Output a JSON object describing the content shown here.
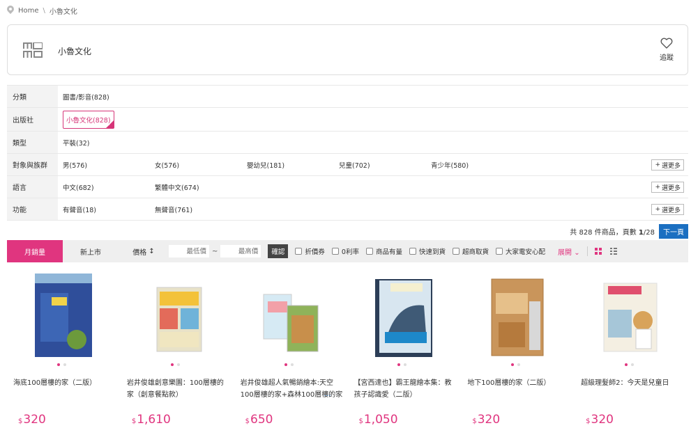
{
  "breadcrumb": {
    "home": "Home",
    "sep": "\\",
    "current": "小魯文化"
  },
  "brand": {
    "logo": "momo",
    "name": "小魯文化",
    "follow_label": "追蹤"
  },
  "filters": [
    {
      "label": "分類",
      "options": [
        "圖書/影音(828)"
      ],
      "more": ""
    },
    {
      "label": "出版社",
      "options": [
        "小魯文化(828)"
      ],
      "selected": 0,
      "more": ""
    },
    {
      "label": "類型",
      "options": [
        "平裝(32)"
      ],
      "more": ""
    },
    {
      "label": "對象與族群",
      "options": [
        "男(576)",
        "女(576)",
        "嬰幼兒(181)",
        "兒童(702)",
        "青少年(580)"
      ],
      "more": "選更多"
    },
    {
      "label": "語言",
      "options": [
        "中文(682)",
        "繁體中文(674)"
      ],
      "more": "選更多"
    },
    {
      "label": "功能",
      "options": [
        "有聲音(18)",
        "無聲音(761)"
      ],
      "more": "選更多"
    }
  ],
  "pageinfo": {
    "prefix": "共",
    "total": "828",
    "mid": "件商品，頁數",
    "current": "1",
    "slash": "/",
    "pages": "28",
    "next": "下一頁"
  },
  "sortbar": {
    "tabs": [
      "月銷量",
      "新上市"
    ],
    "price_label": "價格",
    "price_arrow": "↕",
    "min_placeholder": "最低價",
    "max_placeholder": "最高價",
    "tilde": "~",
    "confirm": "確認",
    "checks": [
      "折價券",
      "0利率",
      "商品有量",
      "快速到貨",
      "超商取貨",
      "大家電安心配"
    ],
    "expand": "展開"
  },
  "products": [
    {
      "name": "海底100層樓的家（二版）",
      "currency": "$",
      "price": "320",
      "cover_color": "#2f4e9a"
    },
    {
      "name": "岩井俊雄創意樂園：100層樓的家（創意餐點款）",
      "currency": "$",
      "price": "1,610",
      "cover_color": "#e8e2c8"
    },
    {
      "name": "岩井俊雄超人氣暢銷繪本:天空100層樓的家+森林100層樓的家",
      "currency": "$",
      "price": "650",
      "cover_color": "#8fb35a"
    },
    {
      "name": "【宮西達也】霸王龍繪本集：教孩子認識愛（二版）",
      "currency": "$",
      "price": "1,050",
      "cover_color": "#3a5f8a"
    },
    {
      "name": "地下100層樓的家（二版）",
      "currency": "$",
      "price": "320",
      "cover_color": "#c9955b"
    },
    {
      "name": "超級理髮師2：今天是兒童日",
      "currency": "$",
      "price": "320",
      "cover_color": "#f4efe2"
    }
  ],
  "colors": {
    "accent": "#e0357f",
    "link": "#1b6fc1"
  }
}
